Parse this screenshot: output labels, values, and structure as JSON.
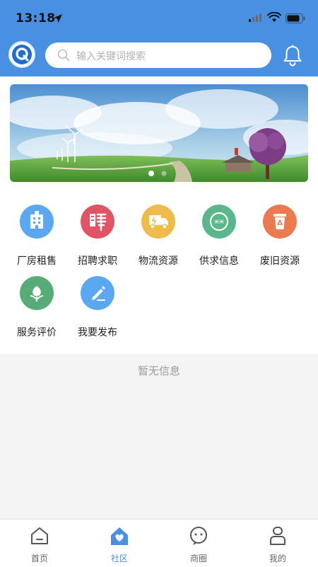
{
  "status_bar": {
    "time": "13:18"
  },
  "header": {
    "search_placeholder": "输入关键词搜索",
    "icons": [
      "app-logo-icon",
      "search-icon",
      "bell-icon"
    ]
  },
  "colors": {
    "brand": "#4a90e2",
    "background": "#f4f4f4"
  },
  "banner": {
    "pages": 2,
    "active_page": 1
  },
  "categories": [
    {
      "label": "厂房租售",
      "color": "#5aa8f2"
    },
    {
      "label": "招聘求职",
      "color": "#e05466"
    },
    {
      "label": "物流资源",
      "color": "#efbb4b"
    },
    {
      "label": "供求信息",
      "color": "#5ab78b"
    },
    {
      "label": "废旧资源",
      "color": "#ec7a50"
    },
    {
      "label": "服务评价",
      "color": "#57ab77"
    },
    {
      "label": "我要发布",
      "color": "#5aa8f2"
    }
  ],
  "empty_text": "暂无信息",
  "tabbar": [
    {
      "label": "首页",
      "active": false
    },
    {
      "label": "社区",
      "active": true
    },
    {
      "label": "商圈",
      "active": false
    },
    {
      "label": "我的",
      "active": false
    }
  ]
}
